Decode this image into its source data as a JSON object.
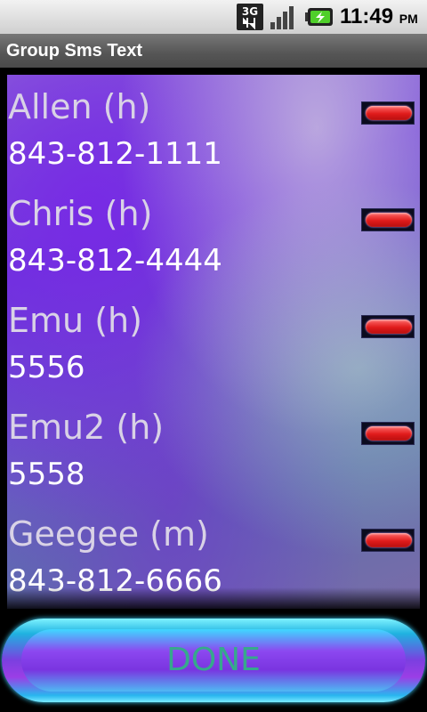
{
  "status_bar": {
    "network_label": "3G",
    "time": "11:49",
    "ampm": "PM"
  },
  "app": {
    "title": "Group Sms Text"
  },
  "contacts": [
    {
      "name": "Allen (h)",
      "number": "843-812-1111"
    },
    {
      "name": "Chris (h)",
      "number": "843-812-4444"
    },
    {
      "name": "Emu (h)",
      "number": "5556"
    },
    {
      "name": "Emu2 (h)",
      "number": "5558"
    },
    {
      "name": "Geegee (m)",
      "number": "843-812-6666"
    }
  ],
  "done_button": {
    "label": "DONE"
  },
  "icons": {
    "network": "3g-data-icon",
    "signal": "signal-strength-icon",
    "battery": "battery-charging-icon",
    "remove": "remove-icon"
  },
  "colors": {
    "title_bar": "#555555",
    "remove_button": "#e01b1b",
    "done_text": "#36a98c",
    "done_glow": "#1fb2e0"
  }
}
